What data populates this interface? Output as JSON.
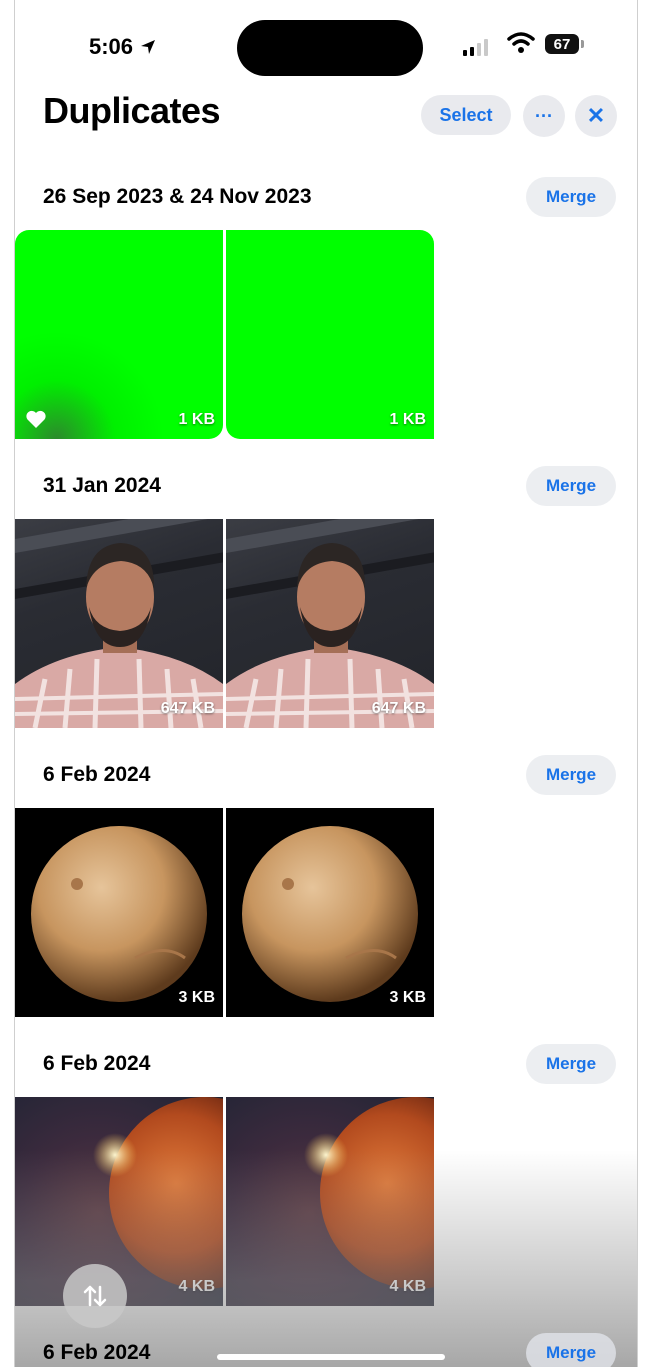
{
  "status_bar": {
    "time": "5:06",
    "battery": "67"
  },
  "header": {
    "title": "Duplicates",
    "select_label": "Select",
    "more_label": "···",
    "close_label": "✕"
  },
  "groups": [
    {
      "date": "26 Sep 2023 & 24 Nov 2023",
      "merge_label": "Merge",
      "items": [
        {
          "size": "1 KB",
          "favorite": true
        },
        {
          "size": "1 KB"
        }
      ]
    },
    {
      "date": "31 Jan 2024",
      "merge_label": "Merge",
      "items": [
        {
          "size": "647 KB"
        },
        {
          "size": "647 KB"
        }
      ]
    },
    {
      "date": "6 Feb 2024",
      "merge_label": "Merge",
      "items": [
        {
          "size": "3 KB"
        },
        {
          "size": "3 KB"
        }
      ]
    },
    {
      "date": "6 Feb 2024",
      "merge_label": "Merge",
      "items": [
        {
          "size": "4 KB"
        },
        {
          "size": "4 KB"
        }
      ]
    },
    {
      "date": "6 Feb 2024",
      "merge_label": "Merge"
    }
  ],
  "colors": {
    "accent": "#1a73e8",
    "pill_bg": "#e9eaee"
  }
}
